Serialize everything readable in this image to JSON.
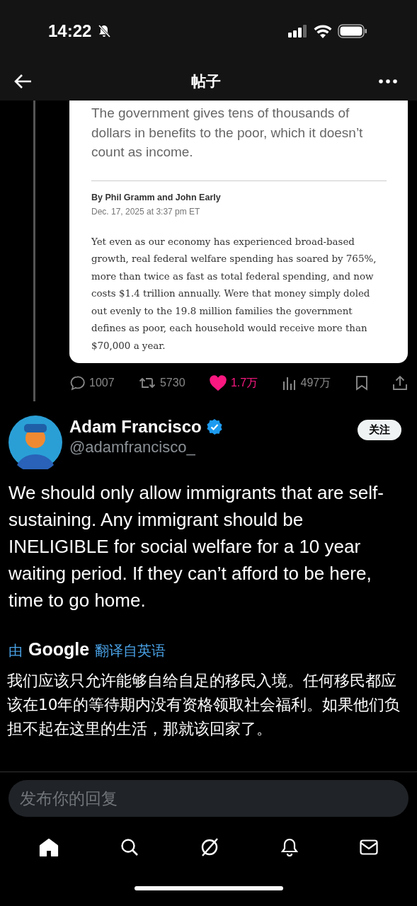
{
  "status_bar": {
    "time": "14:22",
    "silent": true
  },
  "header": {
    "title": "帖子"
  },
  "quoted_article": {
    "subtitle": "The government gives tens of thousands of dollars in benefits to the poor, which it doesn’t count as income.",
    "byline": "By Phil Gramm and John Early",
    "date": "Dec. 17, 2025 at 3:37 pm ET",
    "body": "Yet even as our economy has experienced broad-based growth, real federal welfare spending has soared by 765%, more than twice as fast as total federal spending, and now costs $1.4 trillion annually. Were that money simply doled out evenly to the 19.8 million families the government defines as poor, each household would receive more than $70,000 a year."
  },
  "actions": [
    {
      "kind": "reply",
      "count": "1007",
      "selected": false
    },
    {
      "kind": "repost",
      "count": "5730",
      "selected": false
    },
    {
      "kind": "like",
      "count": "1.7万",
      "selected": true
    },
    {
      "kind": "views",
      "count": "497万",
      "selected": false
    },
    {
      "kind": "bookmark",
      "selected": false
    },
    {
      "kind": "share",
      "selected": false
    }
  ],
  "author": {
    "name": "Adam Francisco",
    "verified": true,
    "handle": "@adamfrancisco_",
    "follow_label": "关注"
  },
  "post_text": "We should only allow immigrants that are self-sustaining. Any immigrant should be INELIGIBLE for social welfare for a 10 year waiting period. If they can’t afford to be here, time to go home.",
  "translation": {
    "prefix": "由",
    "provider": "Google",
    "suffix": "翻译自英语",
    "text": "我们应该只允许能够自给自足的移民入境。任何移民都应该在10年的等待期内没有资格领取社会福利。如果他们负担不起在这里的生活，那就该回家了。"
  },
  "reply_field": {
    "placeholder": "发布你的回复"
  },
  "tabs": [
    {
      "kind": "home",
      "selected": true
    },
    {
      "kind": "search",
      "selected": false
    },
    {
      "kind": "grok",
      "selected": false
    },
    {
      "kind": "notifications",
      "selected": false
    },
    {
      "kind": "messages",
      "selected": false
    }
  ]
}
